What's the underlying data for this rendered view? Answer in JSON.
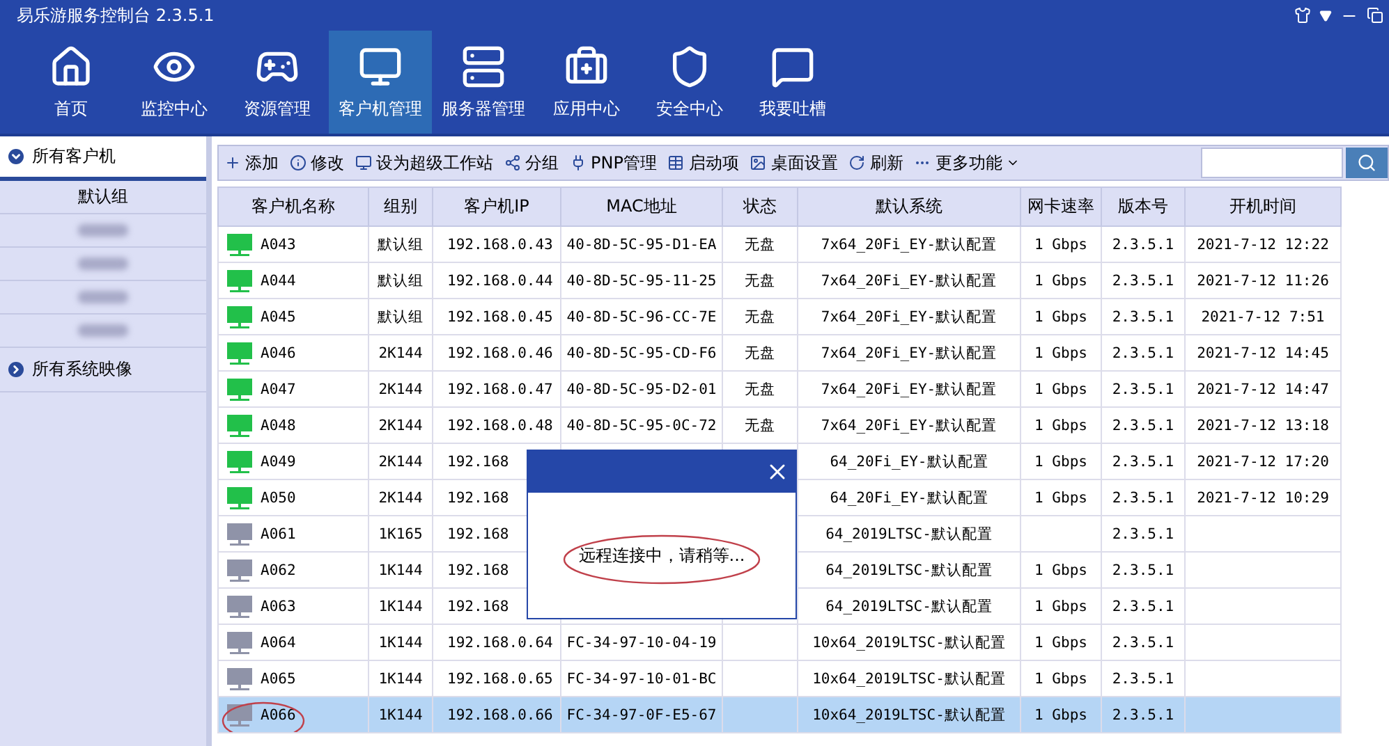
{
  "window": {
    "title": "易乐游服务控制台 2.3.5.1"
  },
  "nav": [
    {
      "label": "首页",
      "selected": false
    },
    {
      "label": "监控中心",
      "selected": false
    },
    {
      "label": "资源管理",
      "selected": false
    },
    {
      "label": "客户机管理",
      "selected": true
    },
    {
      "label": "服务器管理",
      "selected": false
    },
    {
      "label": "应用中心",
      "selected": false
    },
    {
      "label": "安全中心",
      "selected": false
    },
    {
      "label": "我要吐槽",
      "selected": false
    }
  ],
  "sidebar": {
    "sections": [
      {
        "label": "所有客户机",
        "expanded": true,
        "items": [
          {
            "label": "默认组",
            "kind": "text"
          },
          {
            "kind": "blurred"
          },
          {
            "kind": "blurred"
          },
          {
            "kind": "blurred"
          },
          {
            "kind": "blurred"
          }
        ]
      },
      {
        "label": "所有系统映像",
        "expanded": false
      }
    ]
  },
  "toolbar": [
    {
      "label": "添加",
      "dropdown": false
    },
    {
      "label": "修改",
      "dropdown": false
    },
    {
      "label": "设为超级工作站",
      "dropdown": false
    },
    {
      "label": "分组",
      "dropdown": false
    },
    {
      "label": "PNP管理",
      "dropdown": false
    },
    {
      "label": "启动项",
      "dropdown": false
    },
    {
      "label": "桌面设置",
      "dropdown": false
    },
    {
      "label": "刷新",
      "dropdown": false
    },
    {
      "label": "更多功能",
      "dropdown": true
    }
  ],
  "table": {
    "columns": [
      "客户机名称",
      "组别",
      "客户机IP",
      "MAC地址",
      "状态",
      "默认系统",
      "网卡速率",
      "版本号",
      "开机时间"
    ],
    "rows": [
      {
        "online": true,
        "selected": false,
        "cells": [
          "A043",
          "默认组",
          "192.168.0.43",
          "40-8D-5C-95-D1-EA",
          "无盘",
          "7x64_20Fi_EY-默认配置",
          "1 Gbps",
          "2.3.5.1",
          "2021-7-12 12:22"
        ]
      },
      {
        "online": true,
        "selected": false,
        "cells": [
          "A044",
          "默认组",
          "192.168.0.44",
          "40-8D-5C-95-11-25",
          "无盘",
          "7x64_20Fi_EY-默认配置",
          "1 Gbps",
          "2.3.5.1",
          "2021-7-12 11:26"
        ]
      },
      {
        "online": true,
        "selected": false,
        "cells": [
          "A045",
          "默认组",
          "192.168.0.45",
          "40-8D-5C-96-CC-7E",
          "无盘",
          "7x64_20Fi_EY-默认配置",
          "1 Gbps",
          "2.3.5.1",
          "2021-7-12 7:51"
        ]
      },
      {
        "online": true,
        "selected": false,
        "cells": [
          "A046",
          "2K144",
          "192.168.0.46",
          "40-8D-5C-95-CD-F6",
          "无盘",
          "7x64_20Fi_EY-默认配置",
          "1 Gbps",
          "2.3.5.1",
          "2021-7-12 14:45"
        ]
      },
      {
        "online": true,
        "selected": false,
        "cells": [
          "A047",
          "2K144",
          "192.168.0.47",
          "40-8D-5C-95-D2-01",
          "无盘",
          "7x64_20Fi_EY-默认配置",
          "1 Gbps",
          "2.3.5.1",
          "2021-7-12 14:47"
        ]
      },
      {
        "online": true,
        "selected": false,
        "cells": [
          "A048",
          "2K144",
          "192.168.0.48",
          "40-8D-5C-95-0C-72",
          "无盘",
          "7x64_20Fi_EY-默认配置",
          "1 Gbps",
          "2.3.5.1",
          "2021-7-12 13:18"
        ]
      },
      {
        "online": true,
        "selected": false,
        "cells": [
          "A049",
          "2K144",
          "192.168",
          "",
          "",
          "64_20Fi_EY-默认配置",
          "1 Gbps",
          "2.3.5.1",
          "2021-7-12 17:20"
        ]
      },
      {
        "online": true,
        "selected": false,
        "cells": [
          "A050",
          "2K144",
          "192.168",
          "",
          "",
          "64_20Fi_EY-默认配置",
          "1 Gbps",
          "2.3.5.1",
          "2021-7-12 10:29"
        ]
      },
      {
        "online": false,
        "selected": false,
        "cells": [
          "A061",
          "1K165",
          "192.168",
          "",
          "",
          "64_2019LTSC-默认配置",
          "",
          "2.3.5.1",
          ""
        ]
      },
      {
        "online": false,
        "selected": false,
        "cells": [
          "A062",
          "1K144",
          "192.168",
          "",
          "",
          "64_2019LTSC-默认配置",
          "1 Gbps",
          "2.3.5.1",
          ""
        ]
      },
      {
        "online": false,
        "selected": false,
        "cells": [
          "A063",
          "1K144",
          "192.168",
          "",
          "",
          "64_2019LTSC-默认配置",
          "1 Gbps",
          "2.3.5.1",
          ""
        ]
      },
      {
        "online": false,
        "selected": false,
        "cells": [
          "A064",
          "1K144",
          "192.168.0.64",
          "FC-34-97-10-04-19",
          "",
          "10x64_2019LTSC-默认配置",
          "1 Gbps",
          "2.3.5.1",
          ""
        ]
      },
      {
        "online": false,
        "selected": false,
        "cells": [
          "A065",
          "1K144",
          "192.168.0.65",
          "FC-34-97-10-01-BC",
          "",
          "10x64_2019LTSC-默认配置",
          "1 Gbps",
          "2.3.5.1",
          ""
        ]
      },
      {
        "online": false,
        "selected": true,
        "circled": true,
        "cells": [
          "A066",
          "1K144",
          "192.168.0.66",
          "FC-34-97-0F-E5-67",
          "",
          "10x64_2019LTSC-默认配置",
          "1 Gbps",
          "2.3.5.1",
          ""
        ]
      }
    ]
  },
  "dialog": {
    "message": "远程连接中，请稍等...",
    "circled": true
  }
}
